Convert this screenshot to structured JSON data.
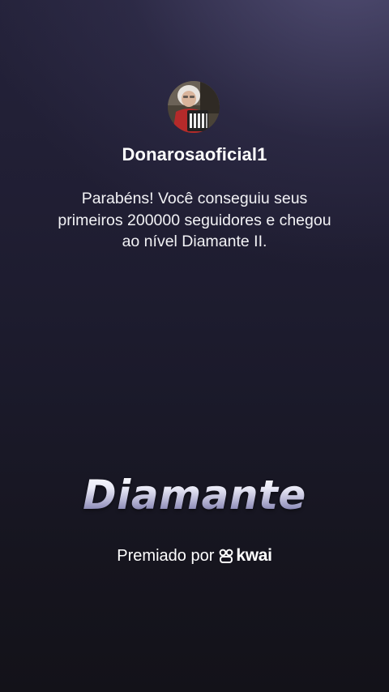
{
  "profile": {
    "username": "Donarosaoficial1",
    "avatar_icon": "user-avatar-photo"
  },
  "message": {
    "text": "Parabéns! Você conseguiu seus primeiros 200000 seguidores e chegou ao nível Diamante II."
  },
  "level": {
    "title": "Diamante"
  },
  "award": {
    "prefix": "Premiado por",
    "brand": "kwai",
    "brand_icon": "kwai-logo-icon"
  },
  "colors": {
    "background_top": "#24223a",
    "background_bottom": "#131219",
    "text": "#ffffff"
  }
}
